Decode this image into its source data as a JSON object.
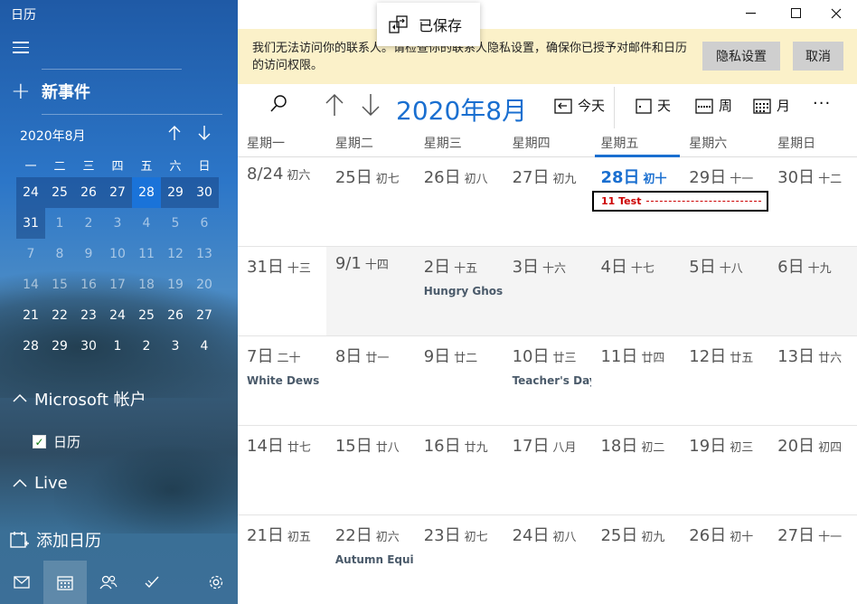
{
  "sidebar": {
    "title": "日历",
    "new_event": "新事件",
    "mini_calendar": {
      "header": "2020年8月",
      "dow": [
        "一",
        "二",
        "三",
        "四",
        "五",
        "六",
        "日"
      ],
      "weeks": [
        [
          "24",
          "25",
          "26",
          "27",
          "28",
          "29",
          "30"
        ],
        [
          "31",
          "1",
          "2",
          "3",
          "4",
          "5",
          "6"
        ],
        [
          "7",
          "8",
          "9",
          "10",
          "11",
          "12",
          "13"
        ],
        [
          "14",
          "15",
          "16",
          "17",
          "18",
          "19",
          "20"
        ],
        [
          "21",
          "22",
          "23",
          "24",
          "25",
          "26",
          "27"
        ],
        [
          "28",
          "29",
          "30",
          "1",
          "2",
          "3",
          "4"
        ]
      ]
    },
    "accounts": [
      {
        "name": "Microsoft 帐户",
        "calendars": [
          {
            "name": "日历",
            "checked": true,
            "check_color": "#107c10"
          }
        ]
      },
      {
        "name": "Live"
      }
    ],
    "add_calendar": "添加日历",
    "bottom_nav": [
      "mail-icon",
      "calendar-icon",
      "people-icon",
      "todo-icon",
      "settings-icon"
    ]
  },
  "toast": {
    "text": "已保存"
  },
  "banner": {
    "text": "我们无法访问你的联系人。请检查你的联系人隐私设置，确保你已授予对邮件和日历 的访问权限。",
    "privacy_button": "隐私设置",
    "cancel_button": "取消",
    "background": "#fbf1c9"
  },
  "toolbar": {
    "month_title": "2020年8月",
    "today": "今天",
    "day": "天",
    "week": "周",
    "month": "月",
    "more": "···",
    "accent": "#1a6fd0"
  },
  "weekdays": [
    "星期一",
    "星期二",
    "星期三",
    "星期四",
    "星期五",
    "星期六",
    "星期日"
  ],
  "weeks": [
    [
      {
        "num": "8/24",
        "lunar": "初六",
        "holiday": ""
      },
      {
        "num": "25日",
        "lunar": "初七",
        "holiday": ""
      },
      {
        "num": "26日",
        "lunar": "初八",
        "holiday": ""
      },
      {
        "num": "27日",
        "lunar": "初九",
        "holiday": ""
      },
      {
        "num": "28日",
        "lunar": "初十",
        "holiday": ""
      },
      {
        "num": "29日",
        "lunar": "十一",
        "holiday": ""
      },
      {
        "num": "30日",
        "lunar": "十二",
        "holiday": ""
      }
    ],
    [
      {
        "num": "31日",
        "lunar": "十三",
        "holiday": ""
      },
      {
        "num": "9/1",
        "lunar": "十四",
        "holiday": ""
      },
      {
        "num": "2日",
        "lunar": "十五",
        "holiday": "Hungry Ghos"
      },
      {
        "num": "3日",
        "lunar": "十六",
        "holiday": ""
      },
      {
        "num": "4日",
        "lunar": "十七",
        "holiday": ""
      },
      {
        "num": "5日",
        "lunar": "十八",
        "holiday": ""
      },
      {
        "num": "6日",
        "lunar": "十九",
        "holiday": ""
      }
    ],
    [
      {
        "num": "7日",
        "lunar": "二十",
        "holiday": "White Dews"
      },
      {
        "num": "8日",
        "lunar": "廿一",
        "holiday": ""
      },
      {
        "num": "9日",
        "lunar": "廿二",
        "holiday": ""
      },
      {
        "num": "10日",
        "lunar": "廿三",
        "holiday": "Teacher's Day"
      },
      {
        "num": "11日",
        "lunar": "廿四",
        "holiday": ""
      },
      {
        "num": "12日",
        "lunar": "廿五",
        "holiday": ""
      },
      {
        "num": "13日",
        "lunar": "廿六",
        "holiday": ""
      }
    ],
    [
      {
        "num": "14日",
        "lunar": "廿七",
        "holiday": ""
      },
      {
        "num": "15日",
        "lunar": "廿八",
        "holiday": ""
      },
      {
        "num": "16日",
        "lunar": "廿九",
        "holiday": ""
      },
      {
        "num": "17日",
        "lunar": "八月",
        "holiday": ""
      },
      {
        "num": "18日",
        "lunar": "初二",
        "holiday": ""
      },
      {
        "num": "19日",
        "lunar": "初三",
        "holiday": ""
      },
      {
        "num": "20日",
        "lunar": "初四",
        "holiday": ""
      }
    ],
    [
      {
        "num": "21日",
        "lunar": "初五",
        "holiday": ""
      },
      {
        "num": "22日",
        "lunar": "初六",
        "holiday": "Autumn Equi"
      },
      {
        "num": "23日",
        "lunar": "初七",
        "holiday": ""
      },
      {
        "num": "24日",
        "lunar": "初八",
        "holiday": ""
      },
      {
        "num": "25日",
        "lunar": "初九",
        "holiday": ""
      },
      {
        "num": "26日",
        "lunar": "初十",
        "holiday": ""
      },
      {
        "num": "27日",
        "lunar": "十一",
        "holiday": ""
      }
    ]
  ],
  "event": {
    "text": "11 Test",
    "color": "#cc0000"
  }
}
